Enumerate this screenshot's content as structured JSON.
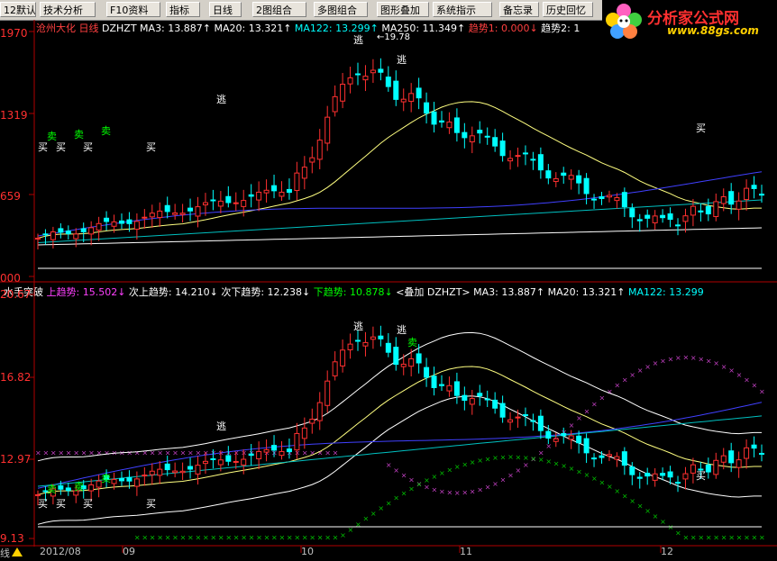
{
  "toolbar": {
    "items": [
      "12默认",
      "技术分析",
      "F10资料",
      "指标",
      "日线",
      "2图组合",
      "多图组合",
      "图形叠加",
      "系统指示",
      "备忘录",
      "历史回忆"
    ]
  },
  "logo": {
    "brand": "分析家公式网",
    "url": "www.88gs.com"
  },
  "top_panel": {
    "stock_name": "沧州大化",
    "period": "日线",
    "indicator": "DZHZT",
    "ma3": "MA3: 13.887↑",
    "ma20": "MA20: 13.321↑",
    "ma122": "MA122: 13.299↑",
    "ma250": "MA250: 11.349↑",
    "trend1": "趋势1: 0.000↓",
    "trend2": "趋势2: 1",
    "y_ticks": [
      "1970",
      "1319",
      "659",
      "000"
    ],
    "peak_label": "19.78"
  },
  "bottom_panel": {
    "indicator_name": "水手突破",
    "up_trend": "上趋势: 15.502↓",
    "sub_up": "次上趋势: 14.210↓",
    "sub_down": "次下趋势: 12.238↓",
    "down_trend": "下趋势: 10.878↓",
    "overlay": "<叠加 DZHZT> MA3: 13.887↑",
    "ma20": "MA20: 13.321↑",
    "ma122": "MA122: 13.299",
    "y_ticks": [
      "20.67",
      "16.82",
      "12.97",
      "9.13"
    ]
  },
  "signals": {
    "buy": "买",
    "sell": "卖",
    "escape": "逃"
  },
  "x_axis": {
    "labels": [
      "2012/08",
      "09",
      "10",
      "11",
      "12"
    ],
    "corner": "线"
  },
  "colors": {
    "up": "#ff3030",
    "down": "#00ffff",
    "bg": "#000000",
    "grid_red": "#b00000"
  }
}
